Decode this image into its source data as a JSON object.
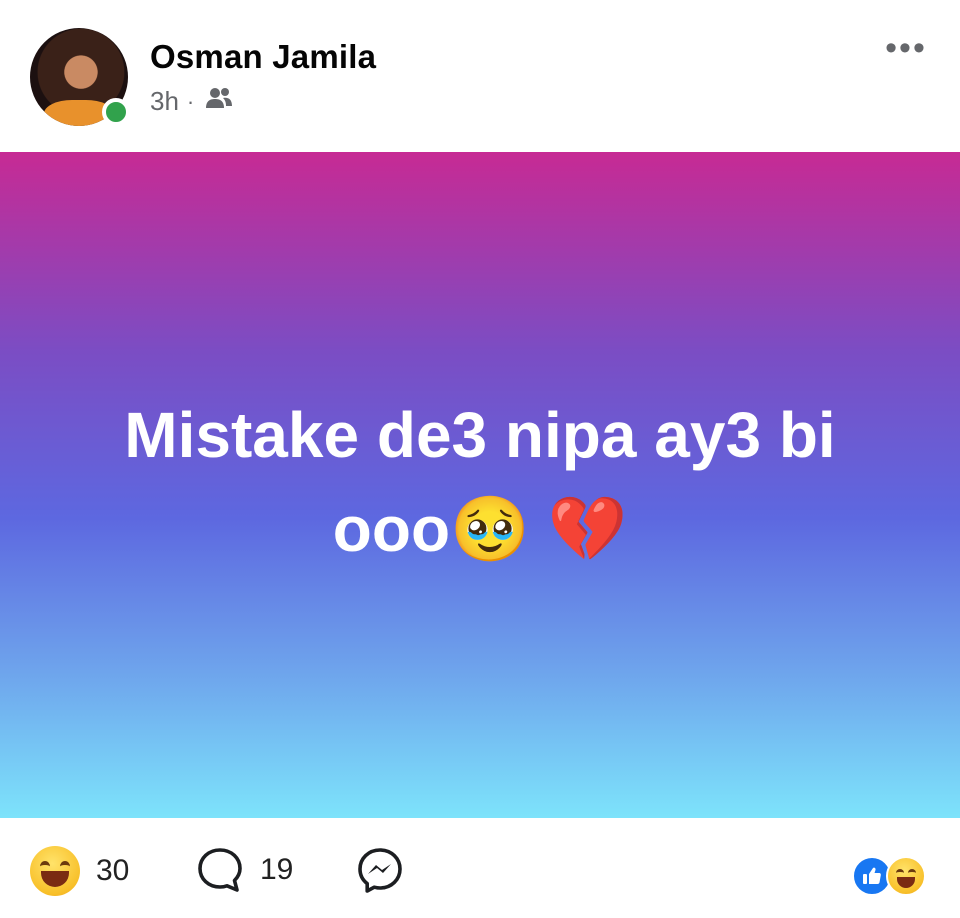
{
  "post": {
    "author": "Osman Jamila",
    "time": "3h",
    "separator": "·",
    "audience_icon": "friends-icon",
    "more_label": "•••",
    "text": "Mistake de3 nipa ay3 bi ooo🥹 💔",
    "background_colors": [
      "#c72a94",
      "#7b4dc4",
      "#5d68e0",
      "#7de3fb"
    ]
  },
  "footer": {
    "reaction_count": "30",
    "comment_count": "19",
    "reaction_icon": "haha-emoji-icon",
    "comment_icon": "comment-icon",
    "share_icon": "messenger-share-icon",
    "summary_icons": [
      "like-icon",
      "haha-icon"
    ]
  },
  "colors": {
    "online": "#31a24c",
    "like_blue": "#1877f2",
    "secondary_text": "#65676b"
  }
}
